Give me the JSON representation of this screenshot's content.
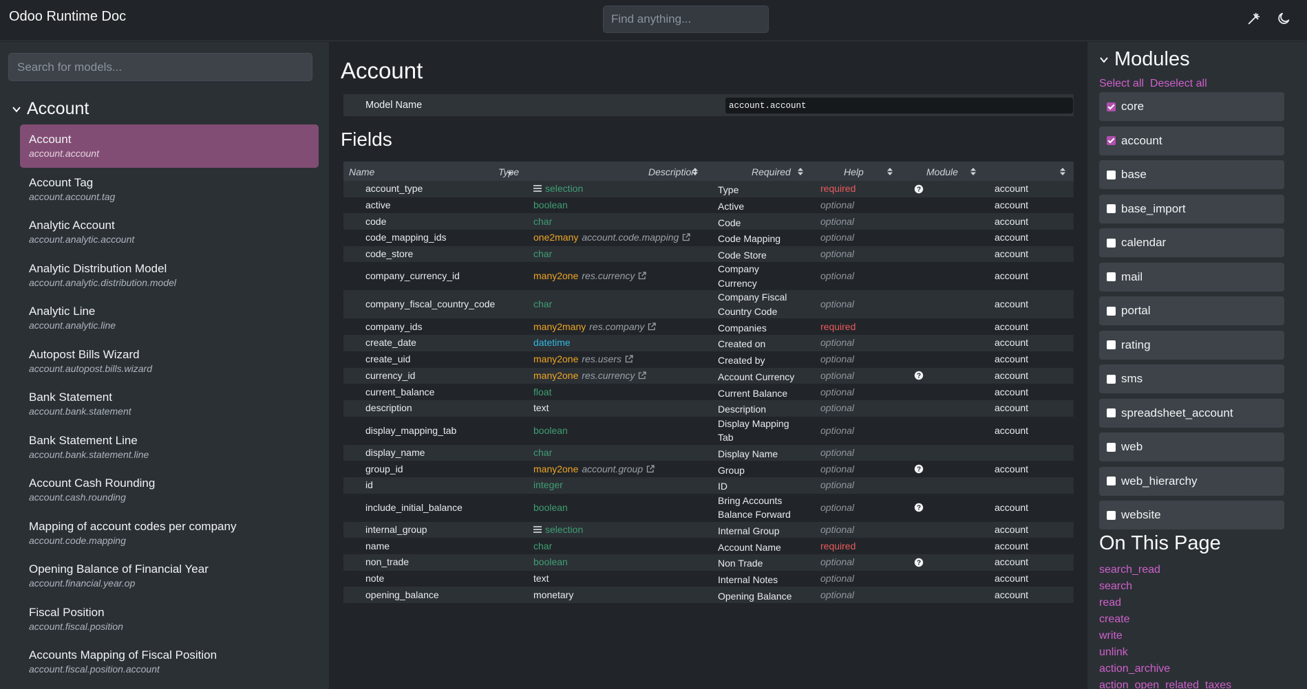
{
  "app": {
    "title": "Odoo Runtime Doc",
    "search_placeholder": "Find anything...",
    "settings_icon": "magic-wand-icon",
    "theme_icon": "moon-icon"
  },
  "sidebar": {
    "search_placeholder": "Search for models...",
    "group_title": "Account",
    "models": [
      {
        "name": "Account",
        "tech": "account.account",
        "active": true
      },
      {
        "name": "Account Tag",
        "tech": "account.account.tag"
      },
      {
        "name": "Analytic Account",
        "tech": "account.analytic.account"
      },
      {
        "name": "Analytic Distribution Model",
        "tech": "account.analytic.distribution.model"
      },
      {
        "name": "Analytic Line",
        "tech": "account.analytic.line"
      },
      {
        "name": "Autopost Bills Wizard",
        "tech": "account.autopost.bills.wizard"
      },
      {
        "name": "Bank Statement",
        "tech": "account.bank.statement"
      },
      {
        "name": "Bank Statement Line",
        "tech": "account.bank.statement.line"
      },
      {
        "name": "Account Cash Rounding",
        "tech": "account.cash.rounding"
      },
      {
        "name": "Mapping of account codes per company",
        "tech": "account.code.mapping"
      },
      {
        "name": "Opening Balance of Financial Year",
        "tech": "account.financial.year.op"
      },
      {
        "name": "Fiscal Position",
        "tech": "account.fiscal.position"
      },
      {
        "name": "Accounts Mapping of Fiscal Position",
        "tech": "account.fiscal.position.account"
      }
    ]
  },
  "main": {
    "title": "Account",
    "model_name_label": "Model Name",
    "model_name_value": "account.account",
    "fields_title": "Fields",
    "columns": [
      "Name",
      "Type",
      "Description",
      "Required",
      "Help",
      "Module"
    ],
    "rows": [
      {
        "name": "account_type",
        "type": "selection",
        "style": "green",
        "menu": true,
        "desc": [
          "Type"
        ],
        "req": "required",
        "help": true,
        "module": "account"
      },
      {
        "name": "active",
        "type": "boolean",
        "style": "green",
        "desc": [
          "Active"
        ],
        "req": "optional",
        "module": "account"
      },
      {
        "name": "code",
        "type": "char",
        "style": "green",
        "desc": [
          "Code"
        ],
        "req": "optional",
        "module": "account"
      },
      {
        "name": "code_mapping_ids",
        "type": "one2many",
        "style": "rel",
        "relmodel": "account.code.mapping",
        "desc": [
          "Code Mapping"
        ],
        "req": "optional",
        "module": "account"
      },
      {
        "name": "code_store",
        "type": "char",
        "style": "green",
        "desc": [
          "Code Store"
        ],
        "req": "optional",
        "module": "account"
      },
      {
        "name": "company_currency_id",
        "type": "many2one",
        "style": "rel",
        "relmodel": "res.currency",
        "desc": [
          "Company",
          "Currency"
        ],
        "req": "optional",
        "module": "account"
      },
      {
        "name": "company_fiscal_country_code",
        "type": "char",
        "style": "green",
        "desc": [
          "Company Fiscal",
          "Country Code"
        ],
        "req": "optional",
        "module": "account"
      },
      {
        "name": "company_ids",
        "type": "many2many",
        "style": "rel",
        "relmodel": "res.company",
        "desc": [
          "Companies"
        ],
        "req": "required",
        "module": "account"
      },
      {
        "name": "create_date",
        "type": "datetime",
        "style": "date",
        "desc": [
          "Created on"
        ],
        "req": "optional",
        "module": "account"
      },
      {
        "name": "create_uid",
        "type": "many2one",
        "style": "rel",
        "relmodel": "res.users",
        "desc": [
          "Created by"
        ],
        "req": "optional",
        "module": "account"
      },
      {
        "name": "currency_id",
        "type": "many2one",
        "style": "rel",
        "relmodel": "res.currency",
        "desc": [
          "Account Currency"
        ],
        "req": "optional",
        "help": true,
        "module": "account"
      },
      {
        "name": "current_balance",
        "type": "float",
        "style": "green",
        "desc": [
          "Current Balance"
        ],
        "req": "optional",
        "module": "account"
      },
      {
        "name": "description",
        "type": "text",
        "style": "plain",
        "desc": [
          "Description"
        ],
        "req": "optional",
        "module": "account"
      },
      {
        "name": "display_mapping_tab",
        "type": "boolean",
        "style": "green",
        "desc": [
          "Display Mapping",
          "Tab"
        ],
        "req": "optional",
        "module": "account"
      },
      {
        "name": "display_name",
        "type": "char",
        "style": "green",
        "desc": [
          "Display Name"
        ],
        "req": "optional",
        "module": ""
      },
      {
        "name": "group_id",
        "type": "many2one",
        "style": "rel",
        "relmodel": "account.group",
        "desc": [
          "Group"
        ],
        "req": "optional",
        "help": true,
        "module": "account"
      },
      {
        "name": "id",
        "type": "integer",
        "style": "green",
        "desc": [
          "ID"
        ],
        "req": "optional",
        "module": ""
      },
      {
        "name": "include_initial_balance",
        "type": "boolean",
        "style": "green",
        "desc": [
          "Bring Accounts",
          "Balance Forward"
        ],
        "req": "optional",
        "help": true,
        "module": "account"
      },
      {
        "name": "internal_group",
        "type": "selection",
        "style": "green",
        "menu": true,
        "desc": [
          "Internal Group"
        ],
        "req": "optional",
        "module": "account"
      },
      {
        "name": "name",
        "type": "char",
        "style": "green",
        "desc": [
          "Account Name"
        ],
        "req": "required",
        "module": "account"
      },
      {
        "name": "non_trade",
        "type": "boolean",
        "style": "green",
        "desc": [
          "Non Trade"
        ],
        "req": "optional",
        "help": true,
        "module": "account"
      },
      {
        "name": "note",
        "type": "text",
        "style": "plain",
        "desc": [
          "Internal Notes"
        ],
        "req": "optional",
        "module": "account"
      },
      {
        "name": "opening_balance",
        "type": "monetary",
        "style": "plain",
        "desc": [
          "Opening Balance"
        ],
        "req": "optional",
        "module": "account"
      }
    ]
  },
  "right": {
    "modules_title": "Modules",
    "select_all": "Select all",
    "deselect_all": "Deselect all",
    "modules": [
      {
        "name": "core",
        "checked": true
      },
      {
        "name": "account",
        "checked": true
      },
      {
        "name": "base",
        "checked": false
      },
      {
        "name": "base_import",
        "checked": false
      },
      {
        "name": "calendar",
        "checked": false
      },
      {
        "name": "mail",
        "checked": false
      },
      {
        "name": "portal",
        "checked": false
      },
      {
        "name": "rating",
        "checked": false
      },
      {
        "name": "sms",
        "checked": false
      },
      {
        "name": "spreadsheet_account",
        "checked": false
      },
      {
        "name": "web",
        "checked": false
      },
      {
        "name": "web_hierarchy",
        "checked": false
      },
      {
        "name": "website",
        "checked": false
      }
    ],
    "on_this_page_title": "On This Page",
    "on_this_page": [
      "search_read",
      "search",
      "read",
      "create",
      "write",
      "unlink",
      "action_archive",
      "action_open_related_taxes"
    ]
  },
  "colors": {
    "accent": "#cf61cb",
    "active_item": "#824d74",
    "relational": "#f0a526",
    "datetime": "#33b8e0",
    "required": "#ea5a5a"
  }
}
